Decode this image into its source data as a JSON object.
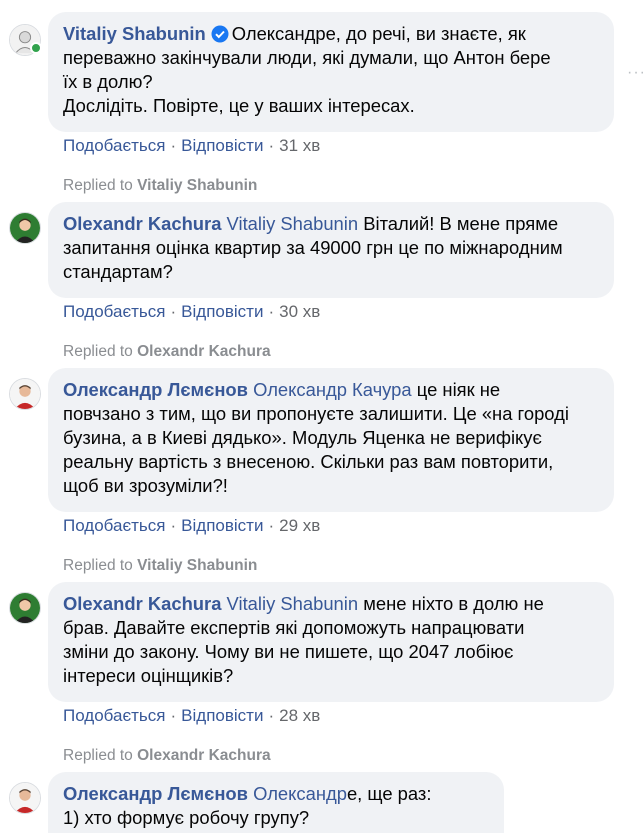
{
  "comments": [
    {
      "author": "Vitaliy Shabunin",
      "verified": true,
      "mention": "",
      "line1_text": "Олександре, до речі, ви знаєте, як",
      "rest_lines": [
        "переважно закінчували люди, які думали, що Антон бере",
        "їх в долю?",
        "Дослідіть. Повірте, це у ваших інтересах."
      ],
      "like": "Подобається",
      "reply": "Відповісти",
      "time": "31 хв"
    },
    {
      "author": "Olexandr Kachura",
      "mention": "Vitaliy Shabunin",
      "line1_text": "Віталий! В мене пряме",
      "rest_lines": [
        "запитання оцінка квартир за 49000 грн це по міжнародним",
        "стандартам?"
      ],
      "like": "Подобається",
      "reply": "Відповісти",
      "time": "30 хв"
    },
    {
      "author": "Олександр Лємєнов",
      "mention": "Олександр Качура",
      "line1_text": "це ніяк не",
      "rest_lines": [
        "повчзано з тим, що ви пропонуєте залишити. Це «на городі",
        "бузина, а в Киеві дядько». Модуль Яценка не верифікує",
        "реальну вартість з внесеною. Скільки раз вам повторити,",
        "щоб ви зрозуміли?!"
      ],
      "like": "Подобається",
      "reply": "Відповісти",
      "time": "29 хв"
    },
    {
      "author": "Olexandr Kachura",
      "mention": "Vitaliy Shabunin",
      "line1_text": "мене ніхто в долю не",
      "rest_lines": [
        "брав. Давайте експертів які допоможуть напрацювати",
        "зміни до закону. Чому ви не пишете, що 2047 лобіює",
        "інтереси оцінщиків?"
      ],
      "like": "Подобається",
      "reply": "Відповісти",
      "time": "28 хв"
    },
    {
      "author": "Олександр Лємєнов",
      "mention": "Олександр",
      "line1_text": "е, ще раз:",
      "rest_lines": [
        "1) хто формує робочу групу?"
      ]
    }
  ],
  "replied": [
    {
      "prefix": "Replied to",
      "name": "Vitaliy Shabunin"
    },
    {
      "prefix": "Replied to",
      "name": "Olexandr Kachura"
    },
    {
      "prefix": "Replied to",
      "name": "Vitaliy Shabunin"
    },
    {
      "prefix": "Replied to",
      "name": "Olexandr Kachura"
    }
  ],
  "more_icon": "more-horizontal-icon",
  "more_glyph": "···",
  "colors": {
    "link": "#385898",
    "bubble": "#f0f2f5",
    "meta": "#65676b",
    "online": "#31a24c"
  }
}
